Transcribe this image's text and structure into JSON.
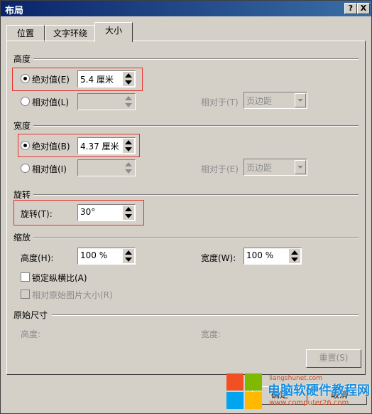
{
  "window": {
    "title": "布局",
    "help_label": "?",
    "close_label": "X"
  },
  "tabs": [
    {
      "label": "位置",
      "active": false
    },
    {
      "label": "文字环绕",
      "active": false
    },
    {
      "label": "大小",
      "active": true
    }
  ],
  "height_section": {
    "title": "高度",
    "absolute_label": "绝对值(E)",
    "absolute_value": "5.4 厘米",
    "relative_label": "相对值(L)",
    "relative_value": "",
    "relative_to_label": "相对于(T)",
    "relative_to_value": "页边距"
  },
  "width_section": {
    "title": "宽度",
    "absolute_label": "绝对值(B)",
    "absolute_value": "4.37 厘米",
    "relative_label": "相对值(I)",
    "relative_value": "",
    "relative_to_label": "相对于(E)",
    "relative_to_value": "页边距"
  },
  "rotate_section": {
    "title": "旋转",
    "rotate_label": "旋转(T):",
    "rotate_value": "30°"
  },
  "scale_section": {
    "title": "缩放",
    "height_label": "高度(H):",
    "height_value": "100 %",
    "width_label": "宽度(W):",
    "width_value": "100 %",
    "lock_aspect_label": "锁定纵横比(A)",
    "relative_original_label": "相对原始图片大小(R)"
  },
  "original_section": {
    "title": "原始尺寸",
    "height_label": "高度:",
    "width_label": "宽度:",
    "reset_label": "重置(S)"
  },
  "footer": {
    "ok_label": "确定",
    "cancel_label": "取消"
  },
  "watermark": {
    "title": "电脑软硬件教程网",
    "top": "liangshunet.com",
    "url": "www.computer26.com"
  },
  "colors": {
    "highlight": "#e8302c",
    "title_bar": "#0a246a",
    "dialog_bg": "#d4d0c8"
  }
}
